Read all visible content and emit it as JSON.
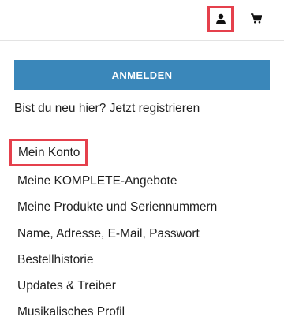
{
  "header": {
    "user_icon": "user-icon",
    "cart_icon": "cart-icon",
    "highlight_color": "#e5404c"
  },
  "account_panel": {
    "login_button_label": "ANMELDEN",
    "login_button_color": "#3a87ba",
    "register_prompt": "Bist du neu hier? Jetzt registrieren"
  },
  "menu": {
    "items": [
      "Mein Konto",
      "Meine KOMPLETE-Angebote",
      "Meine Produkte und Seriennummern",
      "Name, Adresse, E-Mail, Passwort",
      "Bestellhistorie",
      "Updates & Treiber",
      "Musikalisches Profil"
    ]
  }
}
